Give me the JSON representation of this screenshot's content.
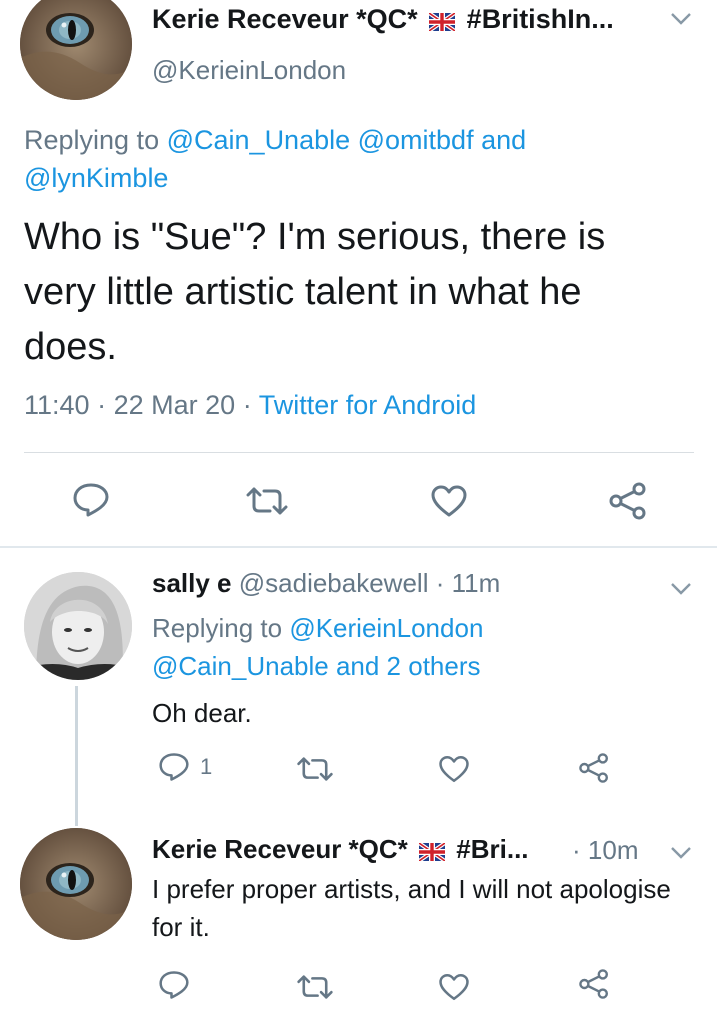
{
  "main_tweet": {
    "author_name": "Kerie Receveur *QC*",
    "author_hashtag": "#BritishIn...",
    "author_handle": "@KerieinLondon",
    "replying_prefix": "Replying to",
    "replying_mentions_1": "@Cain_Unable @omitbdf",
    "replying_and": "and",
    "replying_mentions_2": "@lynKimble",
    "text": "Who is \"Sue\"? I'm serious, there is very little artistic talent in what he does.",
    "time": "11:40",
    "date": "22 Mar 20",
    "source": "Twitter for Android",
    "sep": "·"
  },
  "reply_1": {
    "author_name": "sally e",
    "author_handle": "@sadiebakewell",
    "time_ago": "11m",
    "sep": "·",
    "replying_prefix": "Replying to",
    "replying_mention": "@KerieinLondon",
    "replying_line2": "@Cain_Unable and 2 others",
    "text": "Oh dear.",
    "reply_count": "1"
  },
  "reply_2": {
    "author_name": "Kerie Receveur *QC*",
    "author_hashtag": "#Bri...",
    "time_ago": "10m",
    "sep": "·",
    "text": "I prefer proper artists, and I will not apologise for it."
  },
  "colors": {
    "link": "#1b95e0",
    "secondary_text": "#657786",
    "primary_text": "#14171a",
    "divider": "#e1e8ed"
  },
  "icons": {
    "reply": "reply-icon",
    "retweet": "retweet-icon",
    "like": "heart-icon",
    "share": "share-icon",
    "menu": "chevron-down-icon",
    "flag": "uk-flag-icon"
  }
}
